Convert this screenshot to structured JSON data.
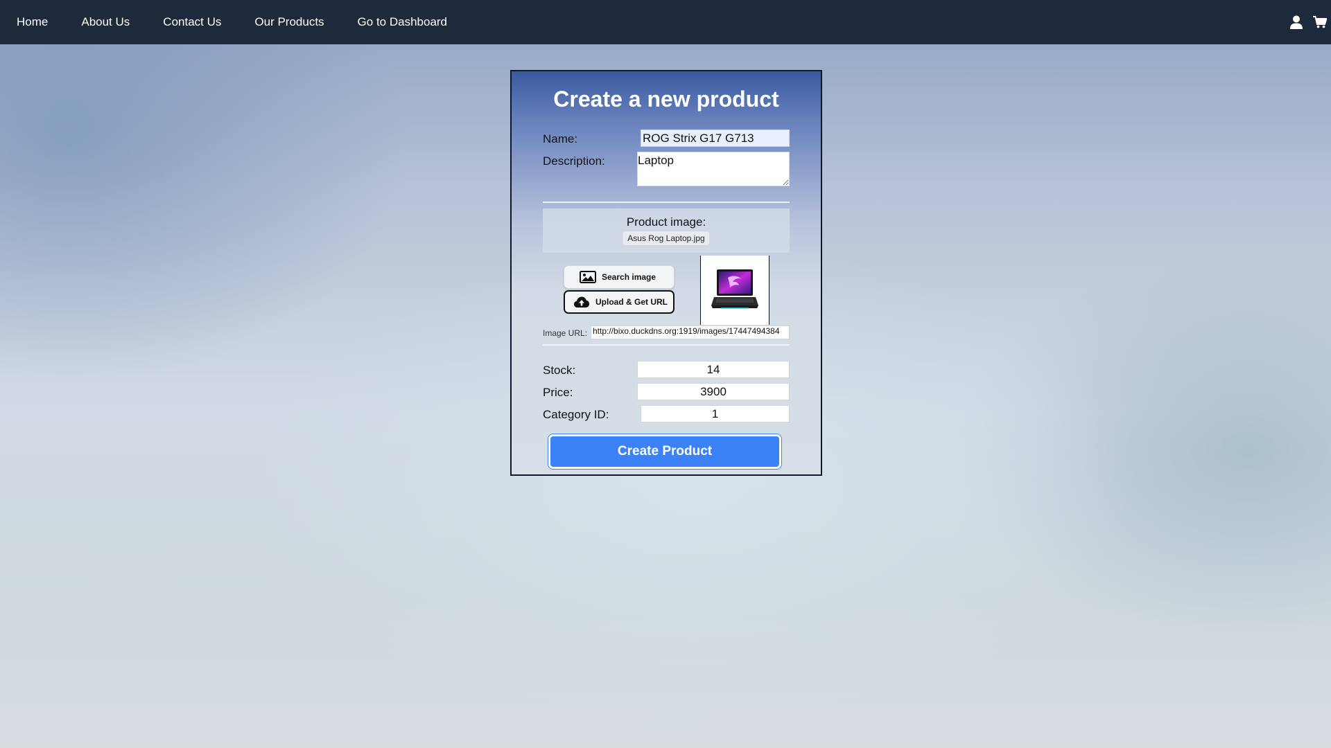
{
  "nav": {
    "links": [
      "Home",
      "About Us",
      "Contact Us",
      "Our Products",
      "Go to Dashboard"
    ],
    "icons": [
      "user-icon",
      "cart-icon"
    ]
  },
  "form": {
    "title": "Create a new product",
    "name_label": "Name:",
    "name_value": "ROG Strix G17 G713",
    "description_label": "Description:",
    "description_value": "Laptop",
    "image_section_title": "Product image:",
    "image_filename": "Asus Rog Laptop.jpg",
    "search_image_label": "Search image",
    "upload_label": "Upload & Get URL",
    "image_url_label": "Image URL:",
    "image_url_value": "http://bixo.duckdns.org:1919/images/17447494384",
    "stock_label": "Stock:",
    "stock_value": "14",
    "price_label": "Price:",
    "price_value": "3900",
    "category_label": "Category ID:",
    "category_value": "1",
    "submit_label": "Create Product"
  },
  "colors": {
    "navbar": "#1e293b",
    "accent": "#3b82f6"
  }
}
